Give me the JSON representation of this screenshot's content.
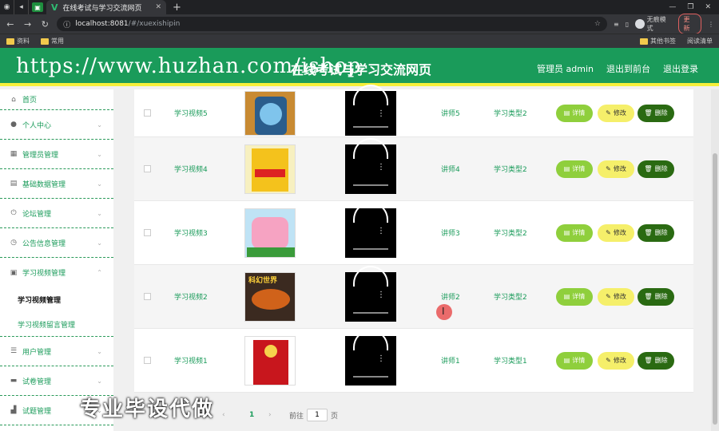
{
  "browser": {
    "tab_title": "在线考试与学习交流网页",
    "url_host": "localhost:8081",
    "url_path": "/#/xuexishipin",
    "incognito_label": "无痕模式",
    "update_label": "更新",
    "bookmarks": [
      "资料",
      "常用"
    ],
    "bookmarks_right": [
      "其他书签",
      "阅读清单"
    ]
  },
  "header": {
    "title": "在线考试与学习交流网页",
    "watermark": "https://www.huzhan.com/ishop",
    "admin_label": "管理员 admin",
    "back_front": "退出到前台",
    "logout": "退出登录"
  },
  "sidebar": {
    "items": [
      {
        "label": "首页",
        "icon": "home-icon"
      },
      {
        "label": "个人中心",
        "icon": "user-icon"
      },
      {
        "label": "管理员管理",
        "icon": "grid-icon"
      },
      {
        "label": "基础数据管理",
        "icon": "clipboard-icon"
      },
      {
        "label": "论坛管理",
        "icon": "power-icon"
      },
      {
        "label": "公告信息管理",
        "icon": "clock-icon"
      },
      {
        "label": "学习视频管理",
        "icon": "video-icon"
      },
      {
        "label": "用户管理",
        "icon": "list-icon"
      },
      {
        "label": "试卷管理",
        "icon": "chat-icon"
      },
      {
        "label": "试题管理",
        "icon": "bar-icon"
      }
    ],
    "submenu": [
      {
        "label": "学习视频管理"
      },
      {
        "label": "学习视频留言管理"
      }
    ]
  },
  "table": {
    "rows": [
      {
        "name": "学习视频5",
        "teacher": "讲师5",
        "type": "学习类型2"
      },
      {
        "name": "学习视频4",
        "teacher": "讲师4",
        "type": "学习类型2"
      },
      {
        "name": "学习视频3",
        "teacher": "讲师3",
        "type": "学习类型2"
      },
      {
        "name": "学习视频2",
        "teacher": "讲师2",
        "type": "学习类型2"
      },
      {
        "name": "学习视频1",
        "teacher": "讲师1",
        "type": "学习类型1"
      }
    ],
    "thumb4_title": "科幻世界",
    "btn_detail": "详情",
    "btn_edit": "修改",
    "btn_delete": "删除"
  },
  "pager": {
    "current": "1",
    "prev": "‹",
    "next": "›",
    "goto_label": "前往",
    "goto_value": "1",
    "page_unit": "页"
  },
  "watermark_big": "专业毕设代做"
}
